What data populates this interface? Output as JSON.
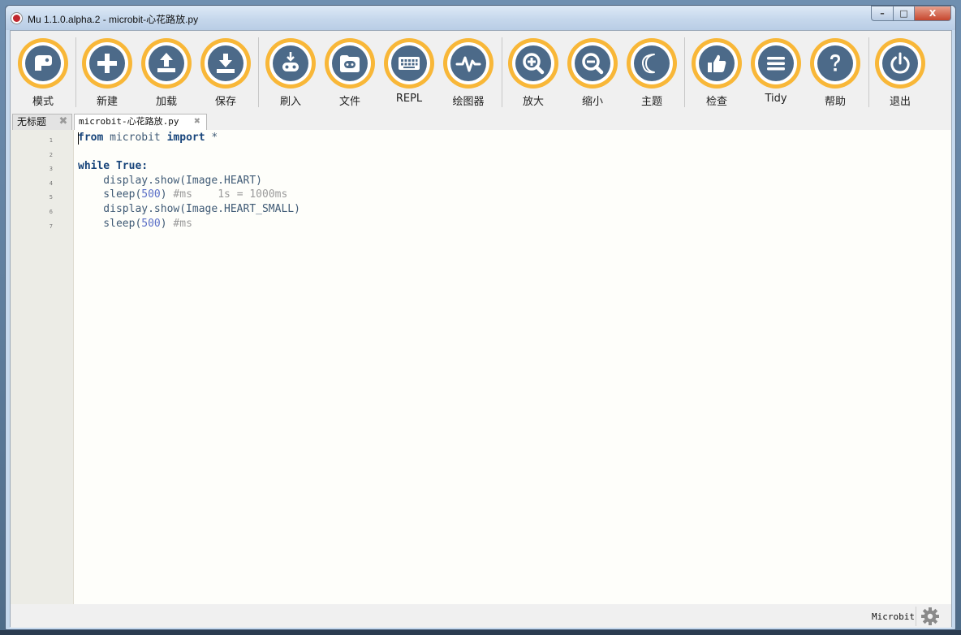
{
  "window": {
    "title": "Mu 1.1.0.alpha.2 - microbit-心花路放.py",
    "controls": {
      "minimize": "–",
      "maximize": "□",
      "close": "X"
    }
  },
  "toolbar": {
    "accent_color": "#f8b738",
    "icon_color": "#4c6a89",
    "buttons": [
      {
        "id": "mode",
        "label": "模式",
        "icon": "mode-icon"
      },
      {
        "id": "new",
        "label": "新建",
        "icon": "plus-icon"
      },
      {
        "id": "load",
        "label": "加载",
        "icon": "upload-icon"
      },
      {
        "id": "save",
        "label": "保存",
        "icon": "download-icon"
      },
      {
        "id": "flash",
        "label": "刷入",
        "icon": "flash-icon"
      },
      {
        "id": "files",
        "label": "文件",
        "icon": "folder-icon"
      },
      {
        "id": "repl",
        "label": "REPL",
        "icon": "keyboard-icon"
      },
      {
        "id": "plotter",
        "label": "绘图器",
        "icon": "pulse-icon"
      },
      {
        "id": "zoom_in",
        "label": "放大",
        "icon": "zoom-in-icon"
      },
      {
        "id": "zoom_out",
        "label": "缩小",
        "icon": "zoom-out-icon"
      },
      {
        "id": "theme",
        "label": "主题",
        "icon": "moon-icon"
      },
      {
        "id": "check",
        "label": "检查",
        "icon": "thumbs-up-icon"
      },
      {
        "id": "tidy",
        "label": "Tidy",
        "icon": "lines-icon"
      },
      {
        "id": "help",
        "label": "帮助",
        "icon": "question-icon"
      },
      {
        "id": "quit",
        "label": "退出",
        "icon": "power-icon"
      }
    ]
  },
  "tabs": [
    {
      "label": "无标题",
      "close": "✖",
      "active": false
    },
    {
      "label": "microbit-心花路放.py",
      "close": "✖",
      "active": true
    }
  ],
  "editor": {
    "line_numbers": [
      "1",
      "2",
      "3",
      "4",
      "5",
      "6",
      "7"
    ],
    "lines": [
      [
        {
          "t": "from",
          "c": "kw"
        },
        {
          "t": " microbit ",
          "c": "id"
        },
        {
          "t": "import",
          "c": "kw"
        },
        {
          "t": " *",
          "c": "id"
        }
      ],
      [],
      [
        {
          "t": "while",
          "c": "kw"
        },
        {
          "t": " ",
          "c": "id"
        },
        {
          "t": "True",
          "c": "kw"
        },
        {
          "t": ":",
          "c": "kw"
        }
      ],
      [
        {
          "t": "    display.show(Image.HEART)",
          "c": "id"
        }
      ],
      [
        {
          "t": "    sleep(",
          "c": "id"
        },
        {
          "t": "500",
          "c": "num"
        },
        {
          "t": ") ",
          "c": "id"
        },
        {
          "t": "#ms    1s = 1000ms",
          "c": "cm"
        }
      ],
      [
        {
          "t": "    display.show(Image.HEART_SMALL)",
          "c": "id"
        }
      ],
      [
        {
          "t": "    sleep(",
          "c": "id"
        },
        {
          "t": "500",
          "c": "num"
        },
        {
          "t": ") ",
          "c": "id"
        },
        {
          "t": "#ms",
          "c": "cm"
        }
      ]
    ]
  },
  "status": {
    "mode": "Microbit",
    "settings_icon": "gear-icon"
  }
}
